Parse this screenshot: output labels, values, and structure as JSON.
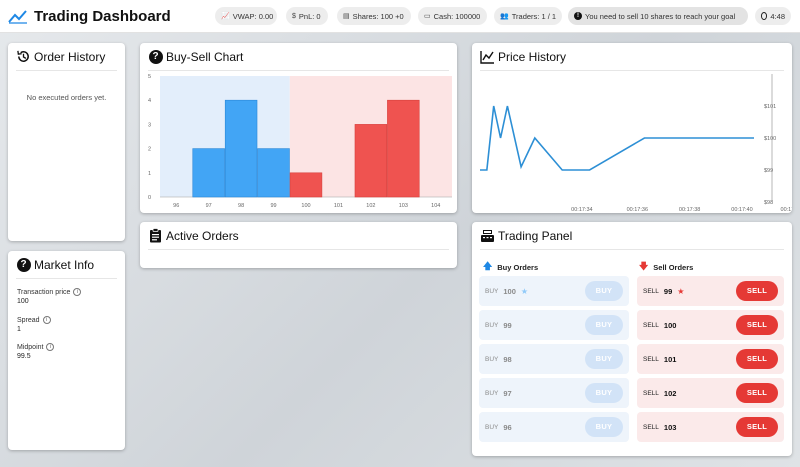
{
  "app": {
    "title": "Trading Dashboard"
  },
  "header": {
    "vwap": "VWAP: 0.00",
    "pnl": "PnL: 0",
    "shares": "Shares: 100 +0",
    "cash": "Cash: 100000",
    "traders": "Traders: 1 / 1",
    "goal": "You need to sell 10 shares to reach your goal",
    "timer": "4:48"
  },
  "order_history": {
    "title": "Order History",
    "empty": "No executed orders yet."
  },
  "market_info": {
    "title": "Market Info",
    "transaction_label": "Transaction price",
    "transaction_value": "100",
    "spread_label": "Spread",
    "spread_value": "1",
    "midpoint_label": "Midpoint",
    "midpoint_value": "99.5"
  },
  "buy_sell_chart": {
    "title": "Buy-Sell Chart",
    "colors": {
      "buy": "#42a5f5",
      "sell": "#ef5350",
      "buy_bg": "#e3eefb",
      "sell_bg": "#fce4e4"
    }
  },
  "active_orders": {
    "title": "Active Orders"
  },
  "price_history": {
    "title": "Price History",
    "line_color": "#2d8fd5"
  },
  "trading_panel": {
    "title": "Trading Panel",
    "buy_header": "Buy Orders",
    "sell_header": "Sell Orders",
    "buy_orders": [
      {
        "side": "BUY",
        "price": "100",
        "starred": true,
        "button": "BUY"
      },
      {
        "side": "BUY",
        "price": "99",
        "starred": false,
        "button": "BUY"
      },
      {
        "side": "BUY",
        "price": "98",
        "starred": false,
        "button": "BUY"
      },
      {
        "side": "BUY",
        "price": "97",
        "starred": false,
        "button": "BUY"
      },
      {
        "side": "BUY",
        "price": "96",
        "starred": false,
        "button": "BUY"
      }
    ],
    "sell_orders": [
      {
        "side": "SELL",
        "price": "99",
        "starred": true,
        "button": "SELL"
      },
      {
        "side": "SELL",
        "price": "100",
        "starred": false,
        "button": "SELL"
      },
      {
        "side": "SELL",
        "price": "101",
        "starred": false,
        "button": "SELL"
      },
      {
        "side": "SELL",
        "price": "102",
        "starred": false,
        "button": "SELL"
      },
      {
        "side": "SELL",
        "price": "103",
        "starred": false,
        "button": "SELL"
      }
    ]
  },
  "chart_data": [
    {
      "type": "bar",
      "title": "Buy-Sell Chart",
      "x_ticks": [
        "96",
        "97",
        "98",
        "99",
        "100",
        "101",
        "102",
        "103",
        "104"
      ],
      "y_ticks": [
        "0",
        "1",
        "2",
        "3",
        "4",
        "5"
      ],
      "xlim": [
        96,
        104
      ],
      "ylim": [
        0,
        5
      ],
      "series": [
        {
          "name": "Buy",
          "x": [
            97,
            98,
            99
          ],
          "values": [
            2,
            4,
            2
          ]
        },
        {
          "name": "Sell",
          "x": [
            100,
            102,
            103
          ],
          "values": [
            1,
            3,
            4
          ]
        }
      ]
    },
    {
      "type": "line",
      "title": "Price History",
      "x_ticks": [
        "00:17:34",
        "00:17:36",
        "00:17:38",
        "00:17:40",
        "00:17:42"
      ],
      "y_ticks": [
        "$98",
        "$99",
        "$100",
        "$101"
      ],
      "x": [
        0,
        0.5,
        1.0,
        1.5,
        2.0,
        3.0,
        4.0,
        6.0,
        8.0,
        12.0,
        16.0,
        20.0
      ],
      "x_unit": "seconds from first point",
      "values": [
        99,
        99.0,
        101,
        100,
        101,
        99.1,
        100,
        99,
        99,
        100,
        100,
        100
      ],
      "ylim": [
        98,
        102
      ]
    }
  ]
}
